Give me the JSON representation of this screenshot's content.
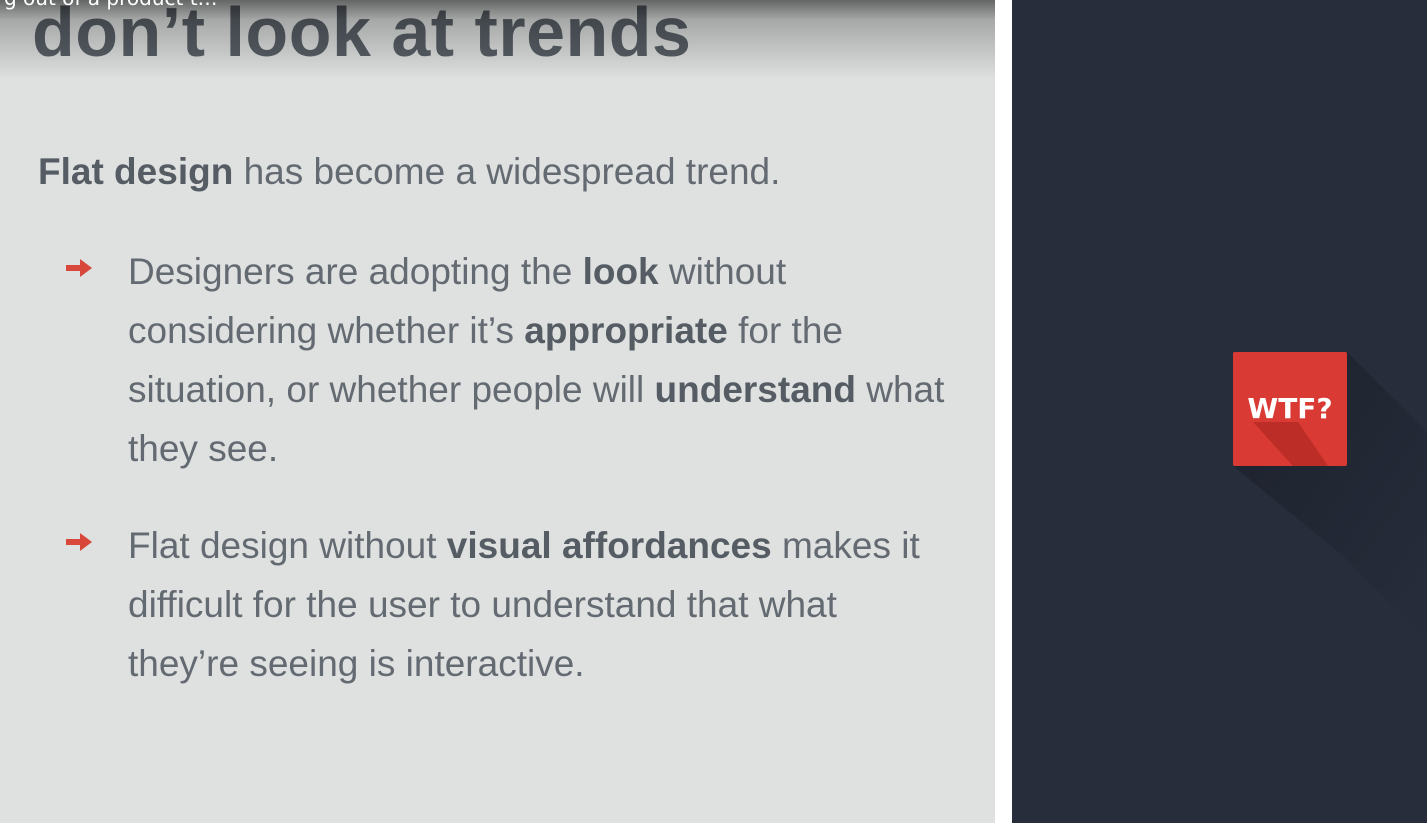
{
  "video": {
    "title_overlay": "g out of a product t…"
  },
  "slide": {
    "heading": "don’t look at trends",
    "intro": {
      "bold": "Flat design",
      "rest": " has become a widespread trend."
    },
    "bullets": [
      {
        "parts": [
          {
            "text": "Designers are adopting the ",
            "bold": false
          },
          {
            "text": "look",
            "bold": true
          },
          {
            "text": " without considering whether it’s ",
            "bold": false
          },
          {
            "text": "appropriate",
            "bold": true
          },
          {
            "text": " for the situation, or whether people will ",
            "bold": false
          },
          {
            "text": "understand",
            "bold": true
          },
          {
            "text": " what they see.",
            "bold": false
          }
        ]
      },
      {
        "parts": [
          {
            "text": "Flat design without ",
            "bold": false
          },
          {
            "text": "visual affordances",
            "bold": true
          },
          {
            "text": " makes it difficult for the user to understand that what they’re seeing is interactive.",
            "bold": false
          }
        ]
      }
    ],
    "badge": {
      "label": "WTF?"
    }
  },
  "colors": {
    "slide_left_bg": "#dee1e0",
    "slide_right_bg": "#272d3b",
    "badge_red": "#d93a33",
    "bullet_arrow": "#d8473a",
    "text_gray": "#646a71"
  },
  "icons": {
    "bullet": "right-arrow-icon"
  }
}
